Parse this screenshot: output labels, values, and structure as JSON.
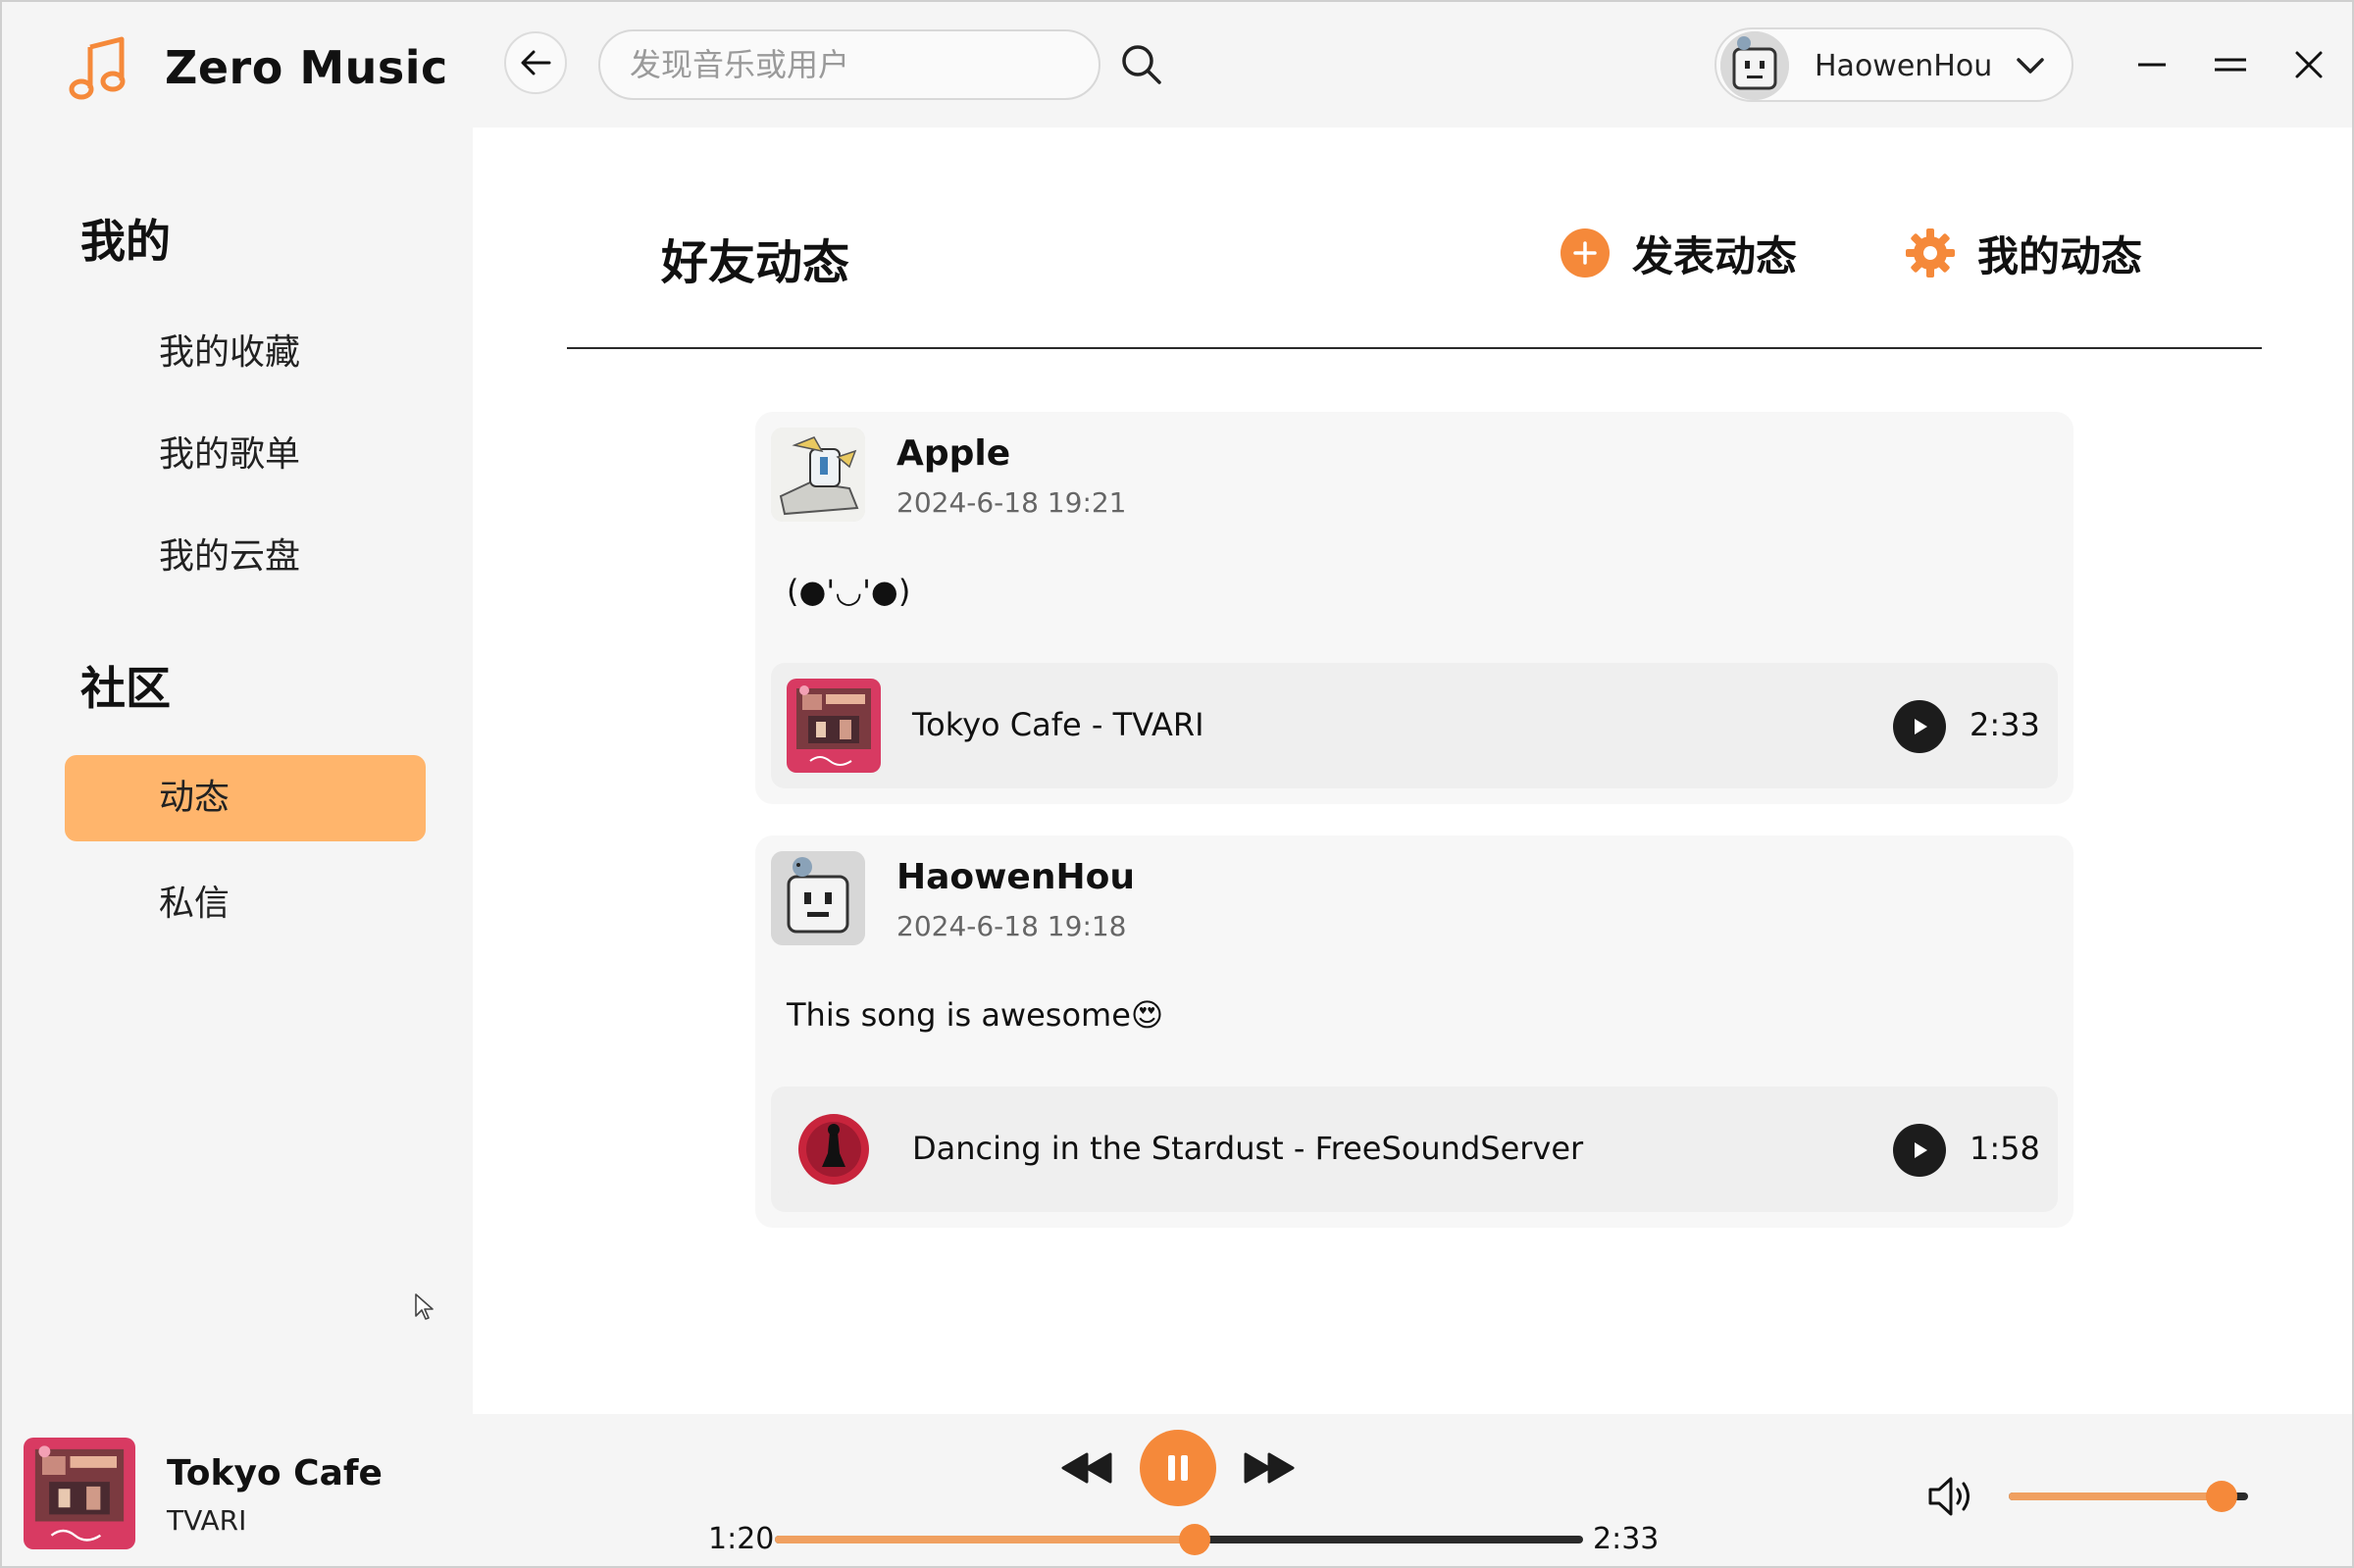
{
  "app": {
    "name": "Zero Music",
    "accent": "#f5893a",
    "accent_light": "#ffb56c"
  },
  "header": {
    "search_placeholder": "发现音乐或用户",
    "user_name": "HaowenHou",
    "icons": [
      "music-note-icon",
      "arrow-left-icon",
      "search-icon",
      "chevron-down-icon",
      "minimize-icon",
      "maximize-icon",
      "close-icon"
    ]
  },
  "sidebar": {
    "section_mine": "我的",
    "items_mine": [
      "我的收藏",
      "我的歌单",
      "我的云盘"
    ],
    "section_community": "社区",
    "items_community": [
      "动态",
      "私信"
    ],
    "active_item": "动态"
  },
  "main": {
    "title": "好友动态",
    "post_button": "发表动态",
    "my_posts_button": "我的动态",
    "posts": [
      {
        "user": "Apple",
        "time": "2024-6-18 19:21",
        "text": "(●'◡'●)",
        "song": "Tokyo Cafe - TVARI",
        "duration": "2:33"
      },
      {
        "user": "HaowenHou",
        "time": "2024-6-18 19:18",
        "text": "This song is awesome😍",
        "song": "Dancing in the Stardust - FreeSoundServer",
        "duration": "1:58"
      }
    ]
  },
  "player": {
    "title": "Tokyo Cafe",
    "artist": "TVARI",
    "elapsed": "1:20",
    "total": "2:33",
    "progress": 0.52,
    "volume": 0.89,
    "state": "playing"
  }
}
